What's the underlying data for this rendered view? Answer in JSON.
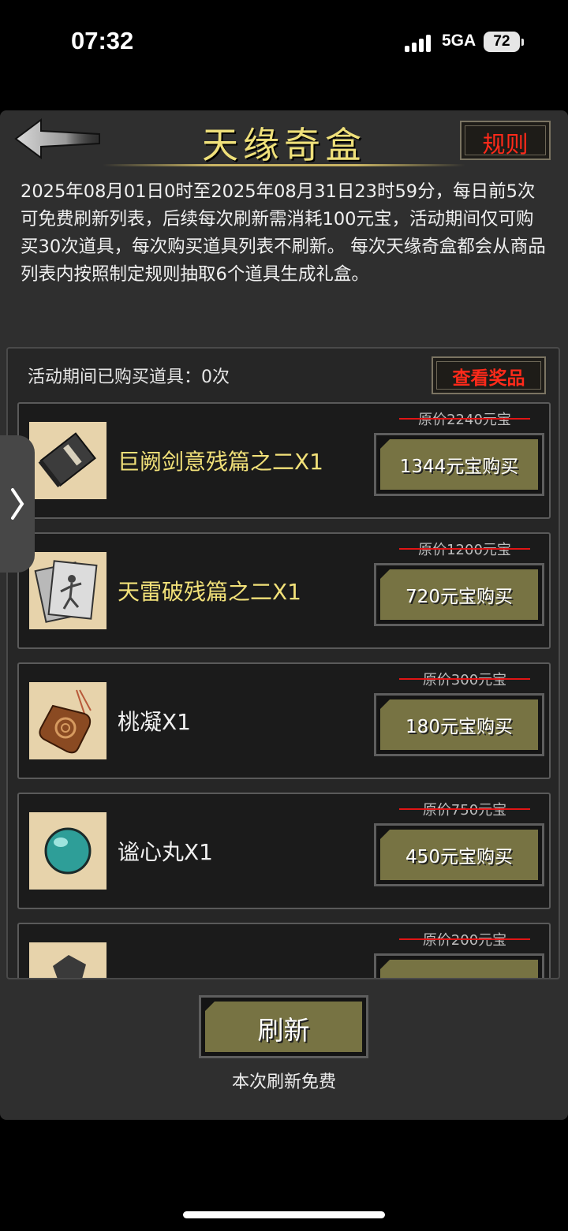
{
  "status_bar": {
    "time": "07:32",
    "network": "5GA",
    "battery": "72"
  },
  "header": {
    "title": "天缘奇盒",
    "rules_label": "规则"
  },
  "description": "2025年08月01日0时至2025年08月31日23时59分，每日前5次可免费刷新列表，后续每次刷新需消耗100元宝，活动期间仅可购买30次道具，每次购买道具列表不刷新。 每次天缘奇盒都会从商品列表内按照制定规则抽取6个道具生成礼盒。",
  "list": {
    "bought_text": "活动期间已购买道具：0次",
    "view_prizes_label": "查看奖品",
    "items": [
      {
        "name": "巨阙剑意残篇之二X1",
        "original_price": "原价2240元宝",
        "buy_label": "1344元宝购买",
        "icon": "book-icon"
      },
      {
        "name": "天雷破残篇之二X1",
        "original_price": "原价1200元宝",
        "buy_label": "720元宝购买",
        "icon": "scroll-pages-icon"
      },
      {
        "name": "桃凝X1",
        "original_price": "原价300元宝",
        "buy_label": "180元宝购买",
        "icon": "jade-pendant-icon"
      },
      {
        "name": "谧心丸X1",
        "original_price": "原价750元宝",
        "buy_label": "450元宝购买",
        "icon": "pill-icon"
      },
      {
        "name": "",
        "original_price": "原价200元宝",
        "buy_label": "",
        "icon": "ore-icon"
      }
    ]
  },
  "footer": {
    "refresh_label": "刷新",
    "refresh_note": "本次刷新免费"
  }
}
